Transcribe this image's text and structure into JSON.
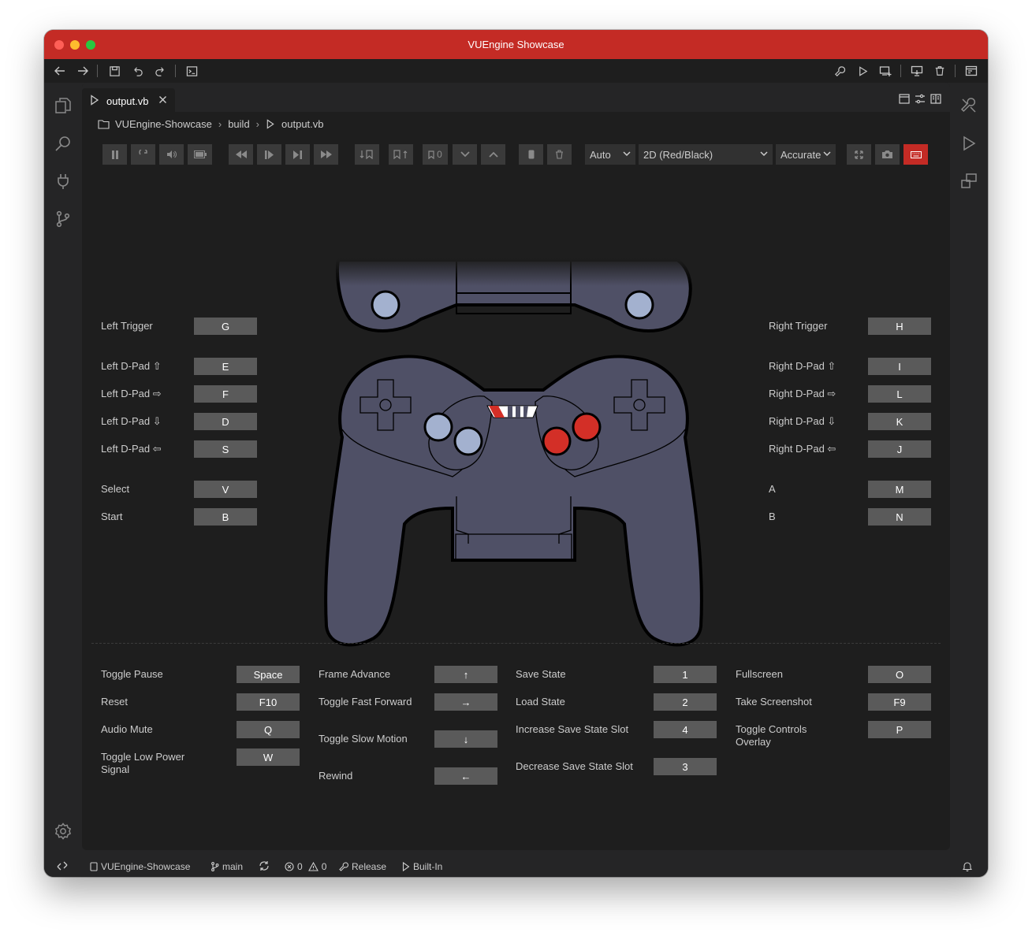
{
  "window": {
    "title": "VUEngine Showcase"
  },
  "tab": {
    "label": "output.vb"
  },
  "breadcrumb": [
    "VUEngine-Showcase",
    "build",
    "output.vb"
  ],
  "emulator": {
    "selects": {
      "scale": "Auto",
      "mode": "2D (Red/Black)",
      "emulation": "Accurate"
    },
    "save_slot_count": "0"
  },
  "controller": {
    "colors": {
      "body": "#4f5066",
      "outline": "#000000",
      "blue_button": "#a3b1cf",
      "red_button": "#d32f27"
    }
  },
  "mappings": {
    "left": [
      {
        "label": "Left Trigger",
        "key": "G"
      },
      {
        "label": "Left D-Pad ⇧",
        "key": "E"
      },
      {
        "label": "Left D-Pad ⇨",
        "key": "F"
      },
      {
        "label": "Left D-Pad ⇩",
        "key": "D"
      },
      {
        "label": "Left D-Pad ⇦",
        "key": "S"
      },
      {
        "label": "Select",
        "key": "V"
      },
      {
        "label": "Start",
        "key": "B"
      }
    ],
    "right": [
      {
        "label": "Right Trigger",
        "key": "H"
      },
      {
        "label": "Right D-Pad ⇧",
        "key": "I"
      },
      {
        "label": "Right D-Pad ⇨",
        "key": "L"
      },
      {
        "label": "Right D-Pad ⇩",
        "key": "K"
      },
      {
        "label": "Right D-Pad ⇦",
        "key": "J"
      },
      {
        "label": "A",
        "key": "M"
      },
      {
        "label": "B",
        "key": "N"
      }
    ]
  },
  "shortcuts": {
    "col1": [
      {
        "label": "Toggle Pause",
        "key": "Space"
      },
      {
        "label": "Reset",
        "key": "F10"
      },
      {
        "label": "Audio Mute",
        "key": "Q"
      },
      {
        "label": "Toggle Low Power Signal",
        "key": "W"
      }
    ],
    "col2": [
      {
        "label": "Frame Advance",
        "key": "↑"
      },
      {
        "label": "Toggle Fast Forward",
        "key": "→"
      },
      {
        "label": "Toggle Slow Motion",
        "key": "↓"
      },
      {
        "label": "Rewind",
        "key": "←"
      }
    ],
    "col3": [
      {
        "label": "Save State",
        "key": "1"
      },
      {
        "label": "Load State",
        "key": "2"
      },
      {
        "label": "Increase Save State Slot",
        "key": "4"
      },
      {
        "label": "Decrease Save State Slot",
        "key": "3"
      }
    ],
    "col4": [
      {
        "label": "Fullscreen",
        "key": "O"
      },
      {
        "label": "Take Screenshot",
        "key": "F9"
      },
      {
        "label": "Toggle Controls Overlay",
        "key": "P"
      }
    ]
  },
  "statusbar": {
    "project": "VUEngine-Showcase",
    "branch": "main",
    "errors": "0",
    "warnings": "0",
    "build_mode": "Release",
    "emulator": "Built-In"
  }
}
